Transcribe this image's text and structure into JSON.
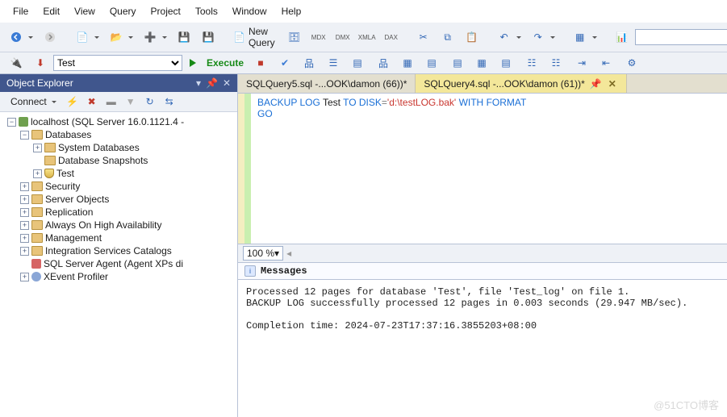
{
  "menu": [
    "File",
    "Edit",
    "View",
    "Query",
    "Project",
    "Tools",
    "Window",
    "Help"
  ],
  "toolbar1": {
    "new_query": "New Query"
  },
  "toolbar2": {
    "db_selector": "Test",
    "execute": "Execute"
  },
  "object_explorer": {
    "title": "Object Explorer",
    "connect": "Connect",
    "root": "localhost (SQL Server 16.0.1121.4 -",
    "nodes": {
      "databases": "Databases",
      "system_db": "System Databases",
      "snapshots": "Database Snapshots",
      "test": "Test",
      "security": "Security",
      "server_objects": "Server Objects",
      "replication": "Replication",
      "aoha": "Always On High Availability",
      "management": "Management",
      "isc": "Integration Services Catalogs",
      "agent": "SQL Server Agent (Agent XPs di",
      "xevent": "XEvent Profiler"
    }
  },
  "tabs": [
    {
      "label": "SQLQuery5.sql -...OOK\\damon (66))*",
      "active": false
    },
    {
      "label": "SQLQuery4.sql -...OOK\\damon (61))*",
      "active": true
    }
  ],
  "sql": {
    "line1_a": "BACKUP",
    "line1_b": "LOG",
    "line1_c": "Test",
    "line1_d": "TO",
    "line1_e": "DISK",
    "line1_eq": "=",
    "line1_str": "'d:\\testLOG.bak'",
    "line1_f": "WITH",
    "line1_g": "FORMAT",
    "line2": "GO"
  },
  "zoom": "100 %",
  "messages": {
    "tab": "Messages",
    "body": "Processed 12 pages for database 'Test', file 'Test_log' on file 1.\nBACKUP LOG successfully processed 12 pages in 0.003 seconds (29.947 MB/sec).\n\nCompletion time: 2024-07-23T17:37:16.3855203+08:00"
  },
  "watermark": "@51CTO博客"
}
